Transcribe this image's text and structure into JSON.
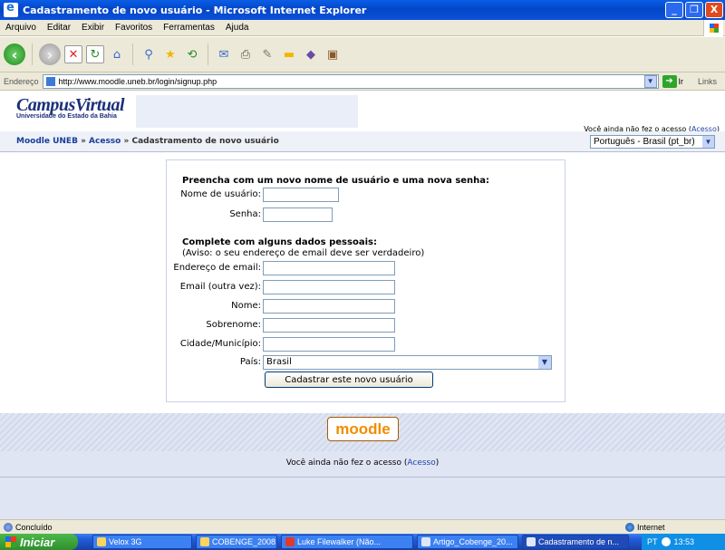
{
  "window": {
    "title": "Cadastramento de novo usuário - Microsoft Internet Explorer",
    "buttons": [
      "_",
      "❐",
      "X"
    ]
  },
  "menu": [
    "Arquivo",
    "Editar",
    "Exibir",
    "Favoritos",
    "Ferramentas",
    "Ajuda"
  ],
  "address": {
    "label": "Endereço",
    "url": "http://www.moodle.uneb.br/login/signup.php",
    "go_label": "Ir",
    "links_label": "Links"
  },
  "site": {
    "logo_main": "CampusVirtual",
    "logo_sub": "Universidade do Estado da Bahia",
    "login_info_text": "Você ainda não fez o acesso (",
    "login_link": "Acesso",
    "login_info_end": ")",
    "breadcrumb": {
      "home": "Moodle UNEB",
      "sep": "»",
      "access": "Acesso",
      "current": "Cadastramento de novo usuário"
    },
    "language": "Português - Brasil (pt_br)"
  },
  "form": {
    "section1_title": "Preencha com um novo nome de usuário e uma nova senha:",
    "username_label": "Nome de usuário:",
    "password_label": "Senha:",
    "section2_title": "Complete com alguns dados pessoais:",
    "section2_note": "(Aviso: o seu endereço de email deve ser verdadeiro)",
    "email_label": "Endereço de email:",
    "email2_label": "Email (outra vez):",
    "firstname_label": "Nome:",
    "lastname_label": "Sobrenome:",
    "city_label": "Cidade/Município:",
    "country_label": "País:",
    "country_value": "Brasil",
    "submit_label": "Cadastrar este novo usuário"
  },
  "footer": {
    "logo": "moodle",
    "text": "Você ainda não fez o acesso (",
    "link": "Acesso",
    "end": ")"
  },
  "status": {
    "left": "Concluído",
    "zone": "Internet"
  },
  "taskbar": {
    "start": "Iniciar",
    "tasks": [
      "Velox 3G",
      "COBENGE_2008",
      "Luke Filewalker (Não...",
      "Artigo_Cobenge_20...",
      "Cadastramento de n..."
    ],
    "lang": "PT",
    "time": "13:53"
  }
}
